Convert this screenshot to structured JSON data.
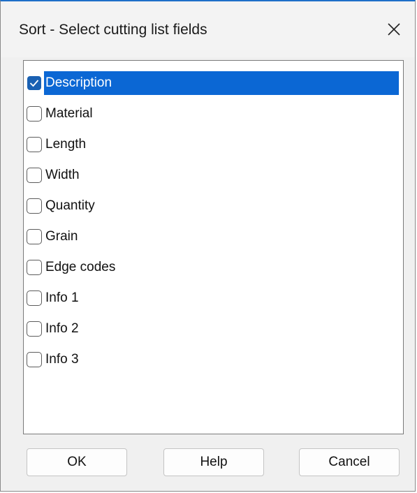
{
  "dialog": {
    "title": "Sort - Select cutting list fields",
    "close_icon": "close-icon"
  },
  "fields": [
    {
      "label": "Description",
      "checked": true,
      "selected": true
    },
    {
      "label": "Material",
      "checked": false,
      "selected": false
    },
    {
      "label": "Length",
      "checked": false,
      "selected": false
    },
    {
      "label": "Width",
      "checked": false,
      "selected": false
    },
    {
      "label": "Quantity",
      "checked": false,
      "selected": false
    },
    {
      "label": "Grain",
      "checked": false,
      "selected": false
    },
    {
      "label": "Edge codes",
      "checked": false,
      "selected": false
    },
    {
      "label": "Info 1",
      "checked": false,
      "selected": false
    },
    {
      "label": "Info 2",
      "checked": false,
      "selected": false
    },
    {
      "label": "Info 3",
      "checked": false,
      "selected": false
    }
  ],
  "buttons": {
    "ok_label": "OK",
    "help_label": "Help",
    "cancel_label": "Cancel"
  },
  "colors": {
    "selection": "#0b67d4",
    "checkbox_checked": "#1a61b3",
    "title_accent": "#1e6fc8"
  }
}
